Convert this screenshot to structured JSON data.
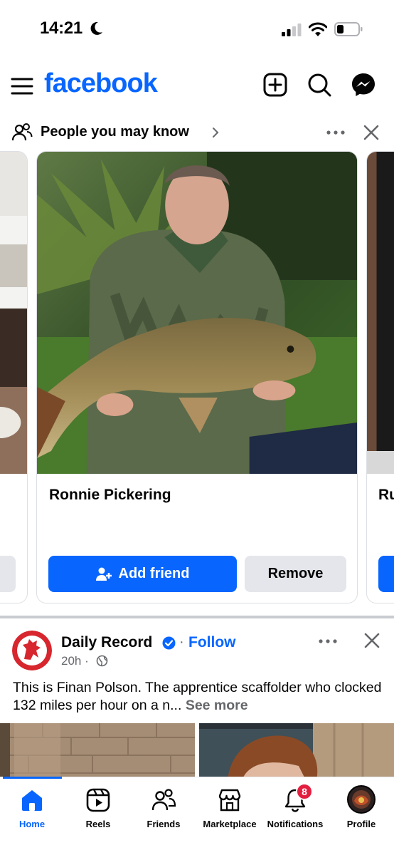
{
  "status_bar": {
    "time": "14:21"
  },
  "header": {
    "brand": "facebook"
  },
  "pymk": {
    "title": "People you may know",
    "card": {
      "name": "Ronnie Pickering",
      "add_label": "Add friend",
      "remove_label": "Remove"
    },
    "next_card_name_partial": "Ru"
  },
  "post": {
    "author": "Daily Record",
    "separator": "·",
    "follow_label": "Follow",
    "time": "20h ·",
    "text": "This is Finan Polson. The apprentice scaffolder who clocked 132 miles per hour on a n...",
    "see_more": "See more"
  },
  "bottom_nav": {
    "items": [
      {
        "label": "Home",
        "icon": "home-icon",
        "active": true
      },
      {
        "label": "Reels",
        "icon": "reels-icon"
      },
      {
        "label": "Friends",
        "icon": "friends-icon"
      },
      {
        "label": "Marketplace",
        "icon": "marketplace-icon"
      },
      {
        "label": "Notifications",
        "icon": "bell-icon",
        "badge": "8"
      },
      {
        "label": "Profile",
        "icon": "profile-avatar"
      }
    ]
  },
  "colors": {
    "accent": "#0866ff",
    "badge": "#e41e3f",
    "secondary_text": "#65676b"
  }
}
